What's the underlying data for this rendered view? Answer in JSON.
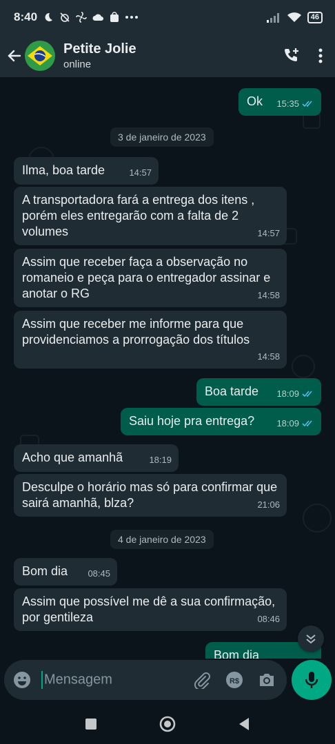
{
  "status_bar": {
    "time": "8:40",
    "battery": "46"
  },
  "header": {
    "contact_name": "Petite Jolie",
    "contact_status": "online"
  },
  "messages": [
    {
      "text": "Ok",
      "time": "15:35"
    },
    {
      "date": "3 de janeiro de 2023"
    },
    {
      "text": "Ilma, boa tarde",
      "time": "14:57"
    },
    {
      "text": "A transportadora fará a entrega dos itens , porém eles entregarão com a falta de 2 volumes",
      "time": "14:57"
    },
    {
      "text": "Assim que receber faça a observação no romaneio e peça para o entregador assinar e anotar o RG",
      "time": "14:58"
    },
    {
      "text": "Assim que receber me informe para que providenciamos a prorrogação dos títulos",
      "time": "14:58"
    },
    {
      "text": "Boa tarde",
      "time": "18:09"
    },
    {
      "text": "Saiu hoje pra entrega?",
      "time": "18:09"
    },
    {
      "text": "Acho que amanhã",
      "time": "18:19"
    },
    {
      "text": "Desculpe o horário mas só para confirmar que sairá amanhã, blza?",
      "time": "21:06"
    },
    {
      "date": "4 de janeiro de 2023"
    },
    {
      "text": "Bom dia",
      "time": "08:45"
    },
    {
      "text": "Assim que possível me dê a sua confirmação, por gentileza",
      "time": "08:46"
    },
    {
      "text": "Bom dia"
    }
  ],
  "composer": {
    "placeholder": "Mensagem"
  },
  "colors": {
    "incoming": "#202c33",
    "outgoing": "#005c4b",
    "accent": "#00a884",
    "read_tick": "#53bdeb"
  }
}
